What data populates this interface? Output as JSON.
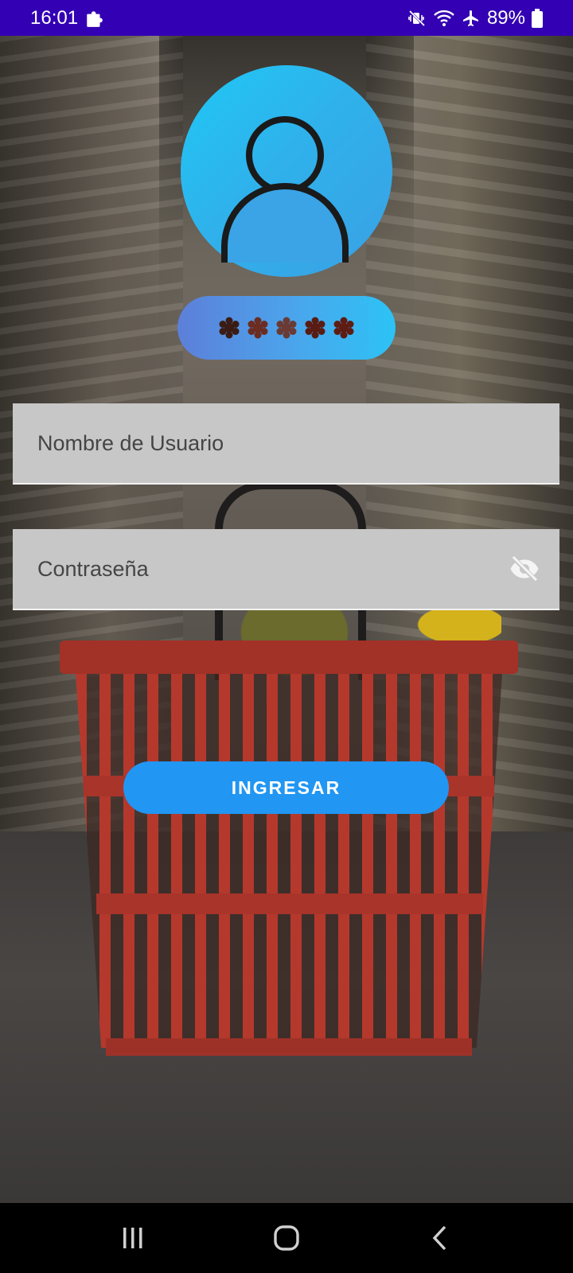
{
  "status_bar": {
    "time": "16:01",
    "battery_percent": "89%",
    "icons": [
      "puzzle-icon",
      "mute-vibrate-icon",
      "wifi-icon",
      "airplane-mode-icon",
      "battery-icon"
    ]
  },
  "login": {
    "avatar_icon": "user-avatar-icon",
    "pin_placeholder_icon": "asterisk-icon",
    "pin_dots": 5,
    "username": {
      "placeholder": "Nombre de Usuario",
      "value": ""
    },
    "password": {
      "placeholder": "Contraseña",
      "value": "",
      "toggle_icon": "eye-off-icon"
    },
    "submit_label": "INGRESAR"
  },
  "colors": {
    "status_bar": "#3300b3",
    "accent": "#2196f3",
    "avatar_gradient_start": "#1fc8f5",
    "avatar_gradient_end": "#3aa0e4",
    "input_background": "#c7c7c7"
  },
  "nav_bar": {
    "icons": [
      "recent-apps-icon",
      "home-icon",
      "back-icon"
    ]
  }
}
